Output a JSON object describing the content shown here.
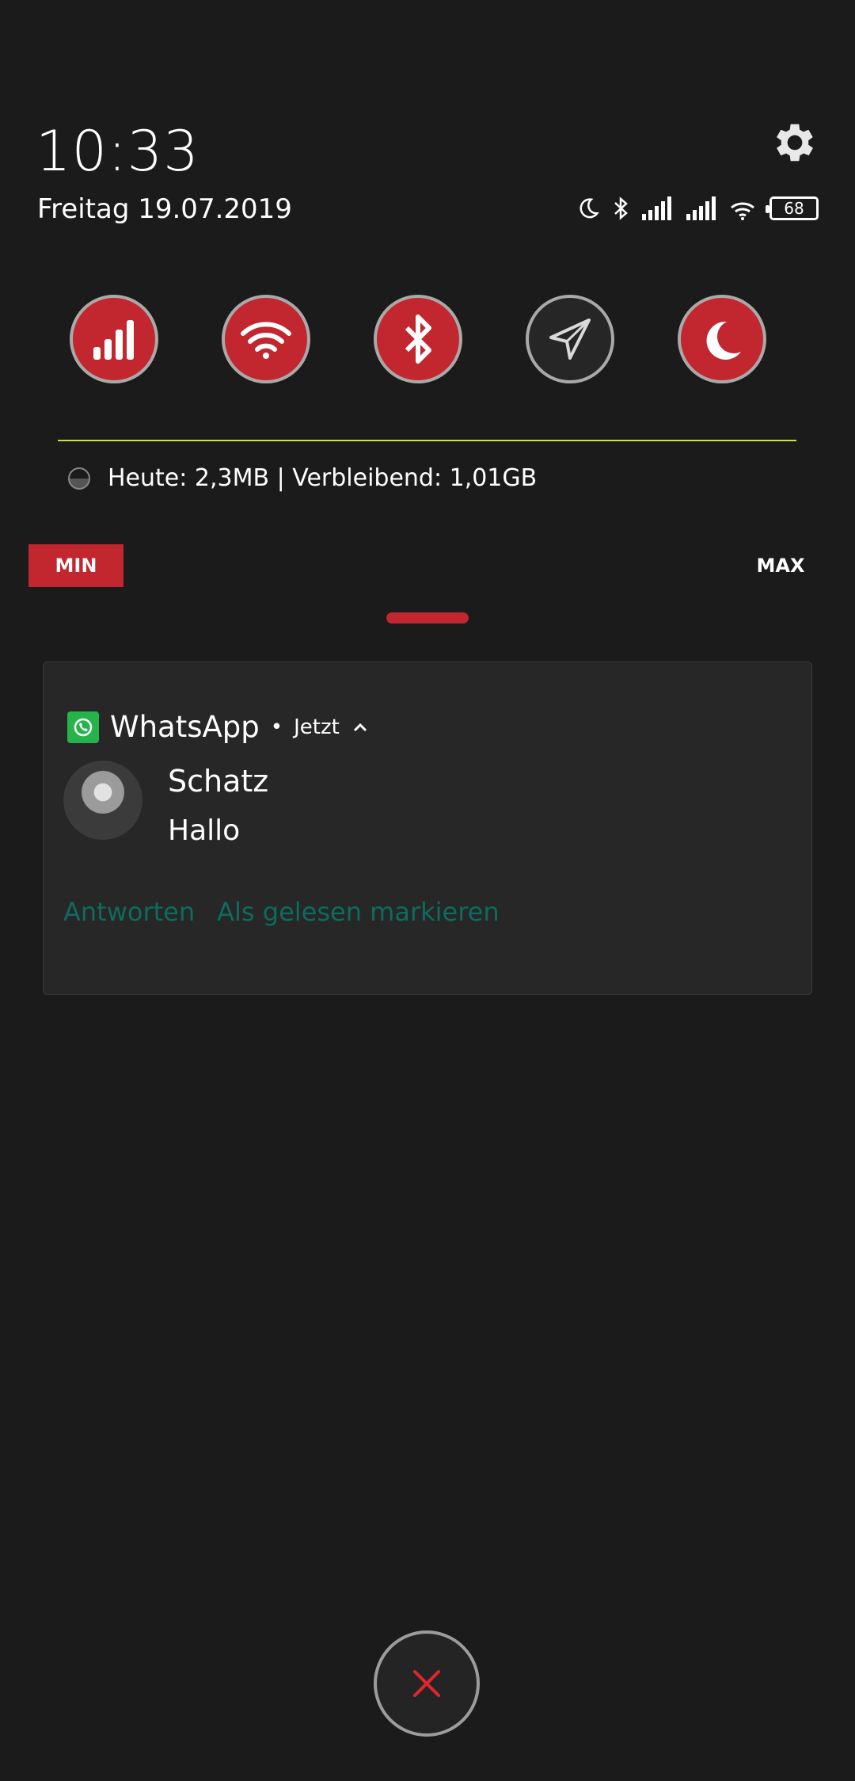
{
  "header": {
    "time": "10:33",
    "date": "Freitag 19.07.2019",
    "settings_icon": "gear-icon"
  },
  "status_bar": {
    "icons": [
      "moon-icon",
      "bluetooth-icon",
      "signal-icon",
      "signal-icon",
      "wifi-icon"
    ],
    "battery": "68"
  },
  "quick_toggles": [
    {
      "name": "mobile-data",
      "icon": "signal-icon",
      "state": "on"
    },
    {
      "name": "wifi",
      "icon": "wifi-icon",
      "state": "on"
    },
    {
      "name": "bluetooth",
      "icon": "bluetooth-icon",
      "state": "on"
    },
    {
      "name": "location",
      "icon": "location-arrow-icon",
      "state": "off"
    },
    {
      "name": "dark-mode",
      "icon": "moon-icon",
      "state": "on"
    }
  ],
  "data_usage": {
    "text": "Heute: 2,3MB | Verbleibend: 1,01GB"
  },
  "brightness": {
    "min_label": "MIN",
    "max_label": "MAX"
  },
  "notification": {
    "app_name": "WhatsApp",
    "separator": "•",
    "time": "Jetzt",
    "sender": "Schatz",
    "message": "Hallo",
    "actions": [
      "Antworten",
      "Als gelesen markieren"
    ]
  },
  "colors": {
    "background": "#1b1b1b",
    "accent_red": "#c2262f",
    "divider_green": "#c2e34a",
    "action_teal": "#0d6b5f",
    "whatsapp_green": "#25b34a"
  }
}
